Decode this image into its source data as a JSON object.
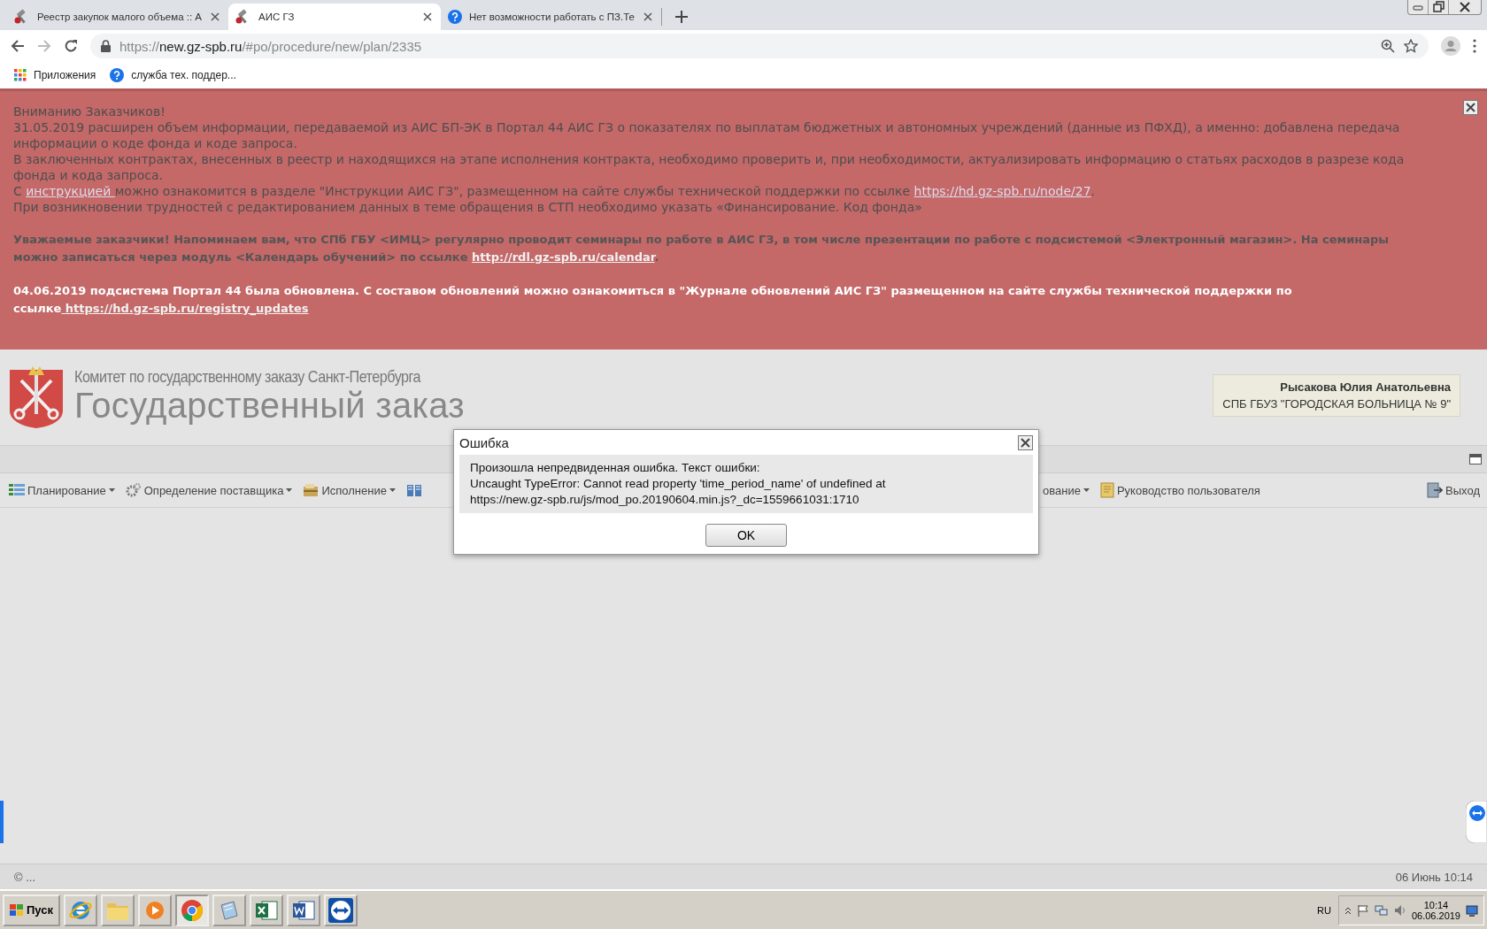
{
  "browser": {
    "tabs": [
      {
        "title": "Реестр закупок малого объема :: А",
        "kind": "gavel",
        "selected": false
      },
      {
        "title": "АИС ГЗ",
        "kind": "gavel",
        "selected": true
      },
      {
        "title": "Нет возможности работать с ПЗ.Те",
        "kind": "help",
        "selected": false
      }
    ],
    "url": {
      "scheme": "https://",
      "host": "new.gz-spb.ru",
      "path": "/#po/procedure/new/plan/2335"
    },
    "bookmarks": [
      {
        "label": "Приложения",
        "kind": "apps"
      },
      {
        "label": "служба тех. поддер...",
        "kind": "help"
      }
    ]
  },
  "notice": {
    "paragraphs": [
      {
        "kind": "plain",
        "lines": [
          [
            {
              "kind": "text",
              "text": "Вниманию Заказчиков!"
            }
          ],
          [
            {
              "kind": "text",
              "text": "31.05.2019 расширен объем информации, передаваемой из АИС БП-ЭК в Портал 44 АИС ГЗ о показателях по выплатам бюджетных и автономных учреждений (данные из ПФХД), а именно: добавлена передача информации о коде фонда и коде запроса."
            }
          ],
          [
            {
              "kind": "text",
              "text": "В заключенных контрактах, внесенных в реестр и находящихся на этапе исполнения контракта, необходимо проверить и, при необходимости, актуализировать информацию о статьях расходов в разрезе кода фонда и кода запроса."
            }
          ],
          [
            {
              "kind": "text",
              "text": "С "
            },
            {
              "kind": "link",
              "text": "инструкцией "
            },
            {
              "kind": "text",
              "text": "можно ознакомится в разделе \"Инструкции АИС ГЗ\", размещенном на сайте службы технической поддержки по ссылке "
            },
            {
              "kind": "link",
              "text": "https://hd.gz-spb.ru/node/27"
            },
            {
              "kind": "text",
              "text": "."
            }
          ],
          [
            {
              "kind": "text",
              "text": "При возникновении трудностей с редактированием данных в теме обращения в СТП необходимо указать «Финансирование. Код фонда»"
            }
          ]
        ]
      },
      {
        "kind": "bold",
        "lines": [
          [
            {
              "kind": "text",
              "text": "Уважаемые заказчики! Напоминаем вам, что СПб ГБУ <ИМЦ> регулярно проводит семинары по работе в АИС ГЗ, в том числе презентации по работе с подсистемой <Электронный магазин>. На семинары можно записаться через модуль <Календарь обучений> по ссылке "
            },
            {
              "kind": "link",
              "text": "http://rdl.gz-spb.ru/calendar"
            },
            {
              "kind": "text",
              "text": "."
            }
          ]
        ]
      },
      {
        "kind": "highlight",
        "lines": [
          [
            {
              "kind": "text",
              "text": "04.06.2019 подсистема Портал 44 была обновлена. С составом обновлений можно ознакомиться в \"Журнале обновлений АИС ГЗ\" размещенном на сайте службы технической поддержки по ссылке"
            },
            {
              "kind": "link",
              "text": " https://hd.gz-spb.ru/registry_updates"
            }
          ]
        ]
      }
    ]
  },
  "header": {
    "org": "Комитет по государственному заказу Санкт-Петербурга",
    "title": "Государственный заказ",
    "user": {
      "name": "Рысакова Юлия Анатольевна",
      "organization": "СПБ ГБУЗ \"ГОРОДСКАЯ БОЛЬНИЦА № 9\""
    }
  },
  "menu": {
    "left": [
      {
        "label": "Планирование",
        "kind": "planning",
        "dropdown": true
      },
      {
        "label": "Определение поставщика",
        "kind": "gear",
        "dropdown": true
      },
      {
        "label": "Исполнение",
        "kind": "box",
        "dropdown": true
      },
      {
        "kind": "book",
        "dropdown": false
      }
    ],
    "right": [
      {
        "label": "ование",
        "kind": "none",
        "dropdown": true
      },
      {
        "label": "Руководство пользователя",
        "kind": "manual",
        "dropdown": false
      }
    ],
    "exit": {
      "label": "Выход",
      "kind": "exit"
    }
  },
  "dialog": {
    "title": "Ошибка",
    "message": [
      "Произошла непредвиденная ошибка. Текст ошибки:",
      "Uncaught TypeError: Cannot read property 'time_period_name' of undefined at",
      "https://new.gz-spb.ru/js/mod_po.20190604.min.js?_dc=1559661031:1710"
    ],
    "button": "OK"
  },
  "footer": {
    "copyright": "© ...",
    "datetime": "06 Июнь 10:14"
  },
  "taskbar": {
    "start": "Пуск",
    "apps": [
      {
        "kind": "ie",
        "selected": false
      },
      {
        "kind": "folder",
        "selected": false
      },
      {
        "kind": "media",
        "selected": false
      },
      {
        "kind": "chrome",
        "selected": true
      },
      {
        "kind": "notepad",
        "selected": false
      },
      {
        "kind": "excel",
        "selected": false
      },
      {
        "kind": "word",
        "selected": false
      },
      {
        "kind": "teamviewer",
        "selected": false
      }
    ],
    "language": "RU",
    "time": "10:14",
    "date": "06.06.2019"
  }
}
